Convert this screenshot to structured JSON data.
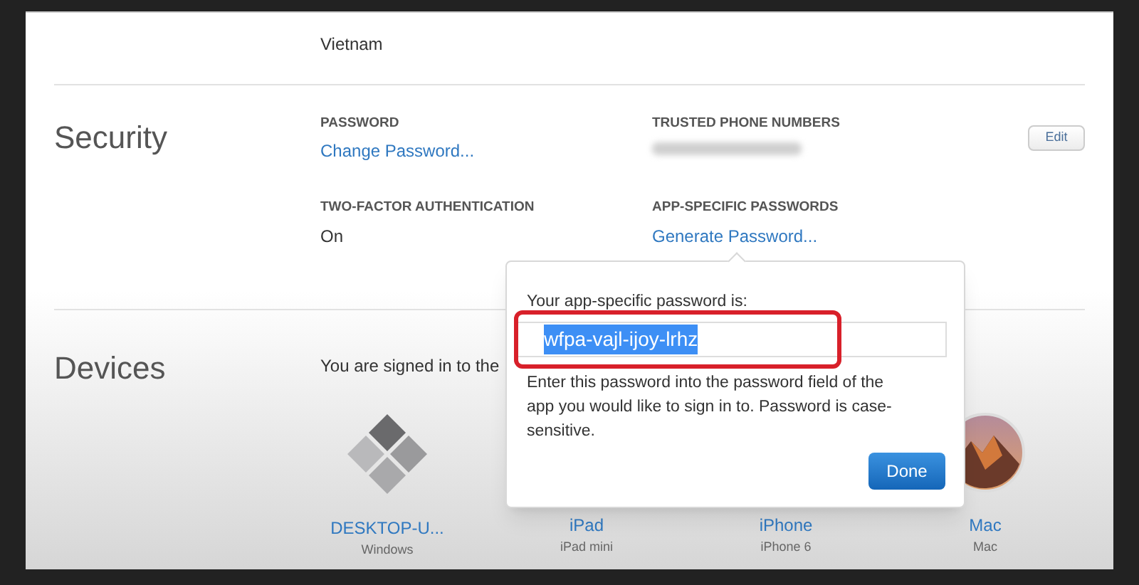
{
  "account": {
    "country_value": "Vietnam"
  },
  "security": {
    "title": "Security",
    "edit_button": "Edit",
    "fields": [
      {
        "kind": "link",
        "label": "PASSWORD",
        "value": "Change Password..."
      },
      {
        "kind": "blurred",
        "label": "TRUSTED PHONE NUMBERS"
      },
      {
        "kind": "text",
        "label": "TWO-FACTOR AUTHENTICATION",
        "value": "On"
      },
      {
        "kind": "link",
        "label": "APP-SPECIFIC PASSWORDS",
        "value": "Generate Password..."
      }
    ]
  },
  "devices": {
    "title": "Devices",
    "intro": "You are signed in to the",
    "items": [
      {
        "kind": "windows",
        "name": "DESKTOP-U...",
        "model": "Windows"
      },
      {
        "kind": "hidden",
        "name": "iPad",
        "model": "iPad mini"
      },
      {
        "kind": "hidden",
        "name": "iPhone",
        "model": "iPhone 6"
      },
      {
        "kind": "mac",
        "name": "Mac",
        "model": "Mac"
      }
    ]
  },
  "popover": {
    "heading": "Your app-specific password is:",
    "password": "wfpa-vajl-ijoy-lrhz",
    "highlighted": true,
    "note": "Enter this password into the password field of the app you would like to sign in to. Password is case-sensitive.",
    "done_button": "Done"
  }
}
